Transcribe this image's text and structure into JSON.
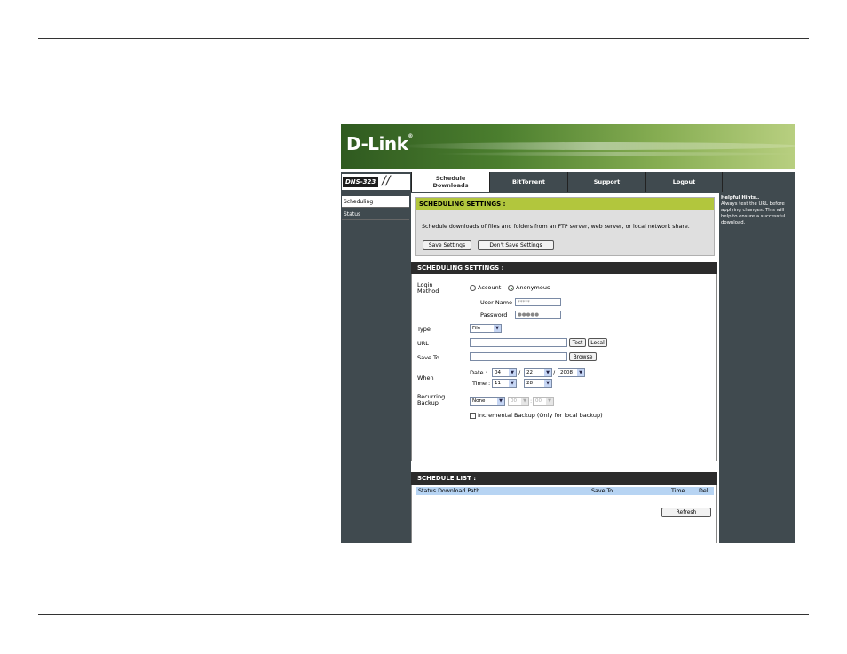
{
  "brand": {
    "logo": "D-Link",
    "reg": "®",
    "model": "DNS-323",
    "slashes": "//"
  },
  "tabs": [
    {
      "label_line1": "Schedule",
      "label_line2": "Downloads"
    },
    {
      "label": "BitTorrent"
    },
    {
      "label": "Support"
    },
    {
      "label": "Logout"
    }
  ],
  "sidebar": {
    "items": [
      {
        "label": "Scheduling"
      },
      {
        "label": "Status"
      }
    ]
  },
  "hints": {
    "title": "Helpful Hints..",
    "body": "Always test the URL before applying changes. This will help to ensure a successful download."
  },
  "intro": {
    "title": "SCHEDULING SETTINGS :",
    "text": "Schedule downloads of files and folders from an FTP server, web server, or local network share.",
    "save_label": "Save Settings",
    "dont_save_label": "Don't Save Settings"
  },
  "settings": {
    "title": "SCHEDULING SETTINGS :",
    "login_method_label_1": "Login",
    "login_method_label_2": "Method",
    "account_label": "Account",
    "anonymous_label": "Anonymous",
    "selected_method": "Anonymous",
    "username_label": "User Name",
    "username_value": "*****",
    "password_label": "Password",
    "password_value": "●●●●●",
    "type_label": "Type",
    "type_value": "File",
    "url_label": "URL",
    "url_value": "",
    "test_label": "Test",
    "local_label": "Local",
    "save_to_label": "Save To",
    "save_to_value": "",
    "browse_label": "Browse",
    "when_label": "When",
    "date_label": "Date :",
    "date_month": "04",
    "date_day": "22",
    "date_year": "2008",
    "date_sep": "/",
    "time_label": "Time :",
    "time_hour": "11",
    "time_minute": "28",
    "recurring_label_1": "Recurring",
    "recurring_label_2": "Backup",
    "recurring_value": "None",
    "recurring_hour": "00",
    "recurring_minute": "00",
    "recurring_sep": ":",
    "incremental_label": "Incremental Backup (Only for local backup)"
  },
  "schedule_list": {
    "title": "SCHEDULE LIST :",
    "columns": {
      "status_path": "Status Download Path",
      "save_to": "Save To",
      "time": "Time",
      "del": "Del"
    },
    "refresh_label": "Refresh"
  }
}
